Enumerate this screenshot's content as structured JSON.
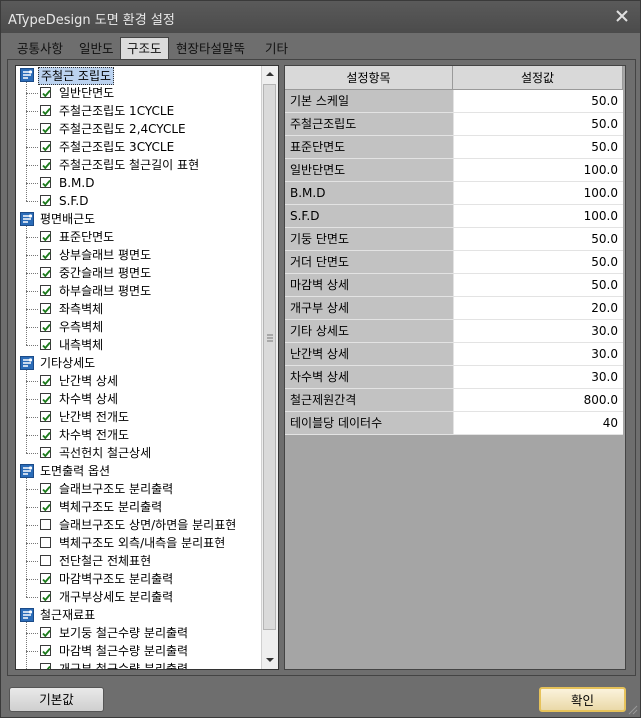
{
  "window": {
    "title": "ATypeDesign 도면 환경 설정"
  },
  "tabs": [
    {
      "label": "공통사항",
      "active": false
    },
    {
      "label": "일반도",
      "active": false
    },
    {
      "label": "구조도",
      "active": true
    },
    {
      "label": "현장타설말뚝",
      "active": false
    },
    {
      "label": "기타",
      "active": false
    }
  ],
  "tree": {
    "groups": [
      {
        "label": "주철근 조립도",
        "selected": true,
        "items": [
          {
            "label": "일반단면도",
            "checked": true
          },
          {
            "label": "주철근조립도 1CYCLE",
            "checked": true
          },
          {
            "label": "주철근조립도 2,4CYCLE",
            "checked": true
          },
          {
            "label": "주철근조립도 3CYCLE",
            "checked": true
          },
          {
            "label": "주철근조립도 철근길이 표현",
            "checked": true
          },
          {
            "label": "B.M.D",
            "checked": true
          },
          {
            "label": "S.F.D",
            "checked": true
          }
        ]
      },
      {
        "label": "평면배근도",
        "selected": false,
        "items": [
          {
            "label": "표준단면도",
            "checked": true
          },
          {
            "label": "상부슬래브 평면도",
            "checked": true
          },
          {
            "label": "중간슬래브 평면도",
            "checked": true
          },
          {
            "label": "하부슬래브 평면도",
            "checked": true
          },
          {
            "label": "좌측벽체",
            "checked": true
          },
          {
            "label": "우측벽체",
            "checked": true
          },
          {
            "label": "내측벽체",
            "checked": true
          }
        ]
      },
      {
        "label": "기타상세도",
        "selected": false,
        "items": [
          {
            "label": "난간벽 상세",
            "checked": true
          },
          {
            "label": "차수벽 상세",
            "checked": true
          },
          {
            "label": "난간벽 전개도",
            "checked": true
          },
          {
            "label": "차수벽 전개도",
            "checked": true
          },
          {
            "label": "곡선헌치 철근상세",
            "checked": true
          }
        ]
      },
      {
        "label": "도면출력 옵션",
        "selected": false,
        "items": [
          {
            "label": "슬래브구조도 분리출력",
            "checked": true
          },
          {
            "label": "벽체구조도 분리출력",
            "checked": true
          },
          {
            "label": "슬래브구조도 상면/하면을 분리표현",
            "checked": false
          },
          {
            "label": "벽체구조도 외측/내측을 분리표현",
            "checked": false
          },
          {
            "label": "전단철근 전체표현",
            "checked": false
          },
          {
            "label": "마감벽구조도 분리출력",
            "checked": true
          },
          {
            "label": "개구부상세도 분리출력",
            "checked": true
          }
        ]
      },
      {
        "label": "철근재료표",
        "selected": false,
        "items": [
          {
            "label": "보기둥 철근수량 분리출력",
            "checked": true
          },
          {
            "label": "마감벽 철근수량 분리출력",
            "checked": true
          },
          {
            "label": "개구부 철근수량 분리출력",
            "checked": true
          }
        ]
      }
    ]
  },
  "grid": {
    "headers": {
      "key": "설정항목",
      "value": "설정값"
    },
    "rows": [
      {
        "key": "기본 스케일",
        "value": "50.0"
      },
      {
        "key": "주철근조립도",
        "value": "50.0"
      },
      {
        "key": "표준단면도",
        "value": "50.0"
      },
      {
        "key": "일반단면도",
        "value": "100.0"
      },
      {
        "key": "B.M.D",
        "value": "100.0"
      },
      {
        "key": "S.F.D",
        "value": "100.0"
      },
      {
        "key": "기둥 단면도",
        "value": "50.0"
      },
      {
        "key": "거더 단면도",
        "value": "50.0"
      },
      {
        "key": "마감벽 상세",
        "value": "50.0"
      },
      {
        "key": "개구부 상세",
        "value": "20.0"
      },
      {
        "key": "기타 상세도",
        "value": "30.0"
      },
      {
        "key": "난간벽 상세",
        "value": "30.0"
      },
      {
        "key": "차수벽 상세",
        "value": "30.0"
      },
      {
        "key": "철근제원간격",
        "value": "800.0"
      },
      {
        "key": "테이블당 데이터수",
        "value": "40"
      }
    ]
  },
  "buttons": {
    "default_label": "기본값",
    "ok_label": "확인"
  },
  "colors": {
    "window_bg": "#6e6e6e",
    "tree_selected": "#bcd3f0",
    "ok_border": "#e6c25a",
    "group_icon": "#2b6cb8"
  },
  "icons": {
    "close": "close-icon",
    "group": "folder-settings-icon",
    "check": "check-icon"
  }
}
